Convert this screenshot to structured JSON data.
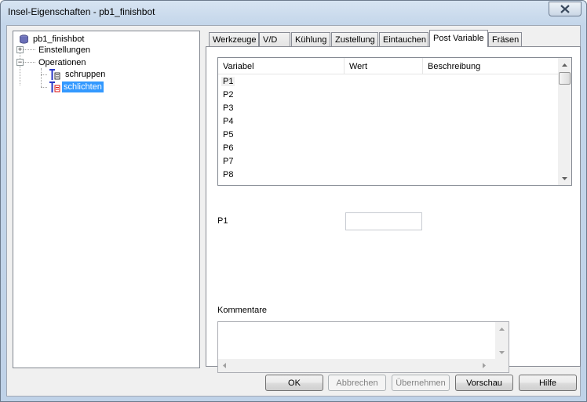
{
  "window": {
    "title": "Insel-Eigenschaften - pb1_finishbot"
  },
  "tree": {
    "root": "pb1_finishbot",
    "items": [
      {
        "label": "Einstellungen",
        "expander": "+"
      },
      {
        "label": "Operationen",
        "expander": "−"
      }
    ],
    "operations": [
      {
        "label": "schruppen",
        "selected": false
      },
      {
        "label": "schlichten",
        "selected": true
      }
    ]
  },
  "tabs": [
    {
      "label": "Werkzeuge",
      "active": false
    },
    {
      "label": "V/D",
      "active": false
    },
    {
      "label": "Kühlung",
      "active": false
    },
    {
      "label": "Zustellung",
      "active": false
    },
    {
      "label": "Eintauchen",
      "active": false
    },
    {
      "label": "Post Variable",
      "active": true
    },
    {
      "label": "Fräsen",
      "active": false
    }
  ],
  "variable_table": {
    "columns": [
      "Variabel",
      "Wert",
      "Beschreibung"
    ],
    "rows": [
      "P1",
      "P2",
      "P3",
      "P4",
      "P5",
      "P6",
      "P7",
      "P8"
    ]
  },
  "selected_variable": {
    "label": "P1",
    "value": ""
  },
  "comments": {
    "label": "Kommentare",
    "value": ""
  },
  "buttons": {
    "ok": "OK",
    "cancel": "Abbrechen",
    "apply": "Übernehmen",
    "preview": "Vorschau",
    "help": "Hilfe"
  },
  "colors": {
    "selection": "#3399ff",
    "dialog_bg": "#f0f0f0",
    "titlebar": "#c4d6ea"
  }
}
